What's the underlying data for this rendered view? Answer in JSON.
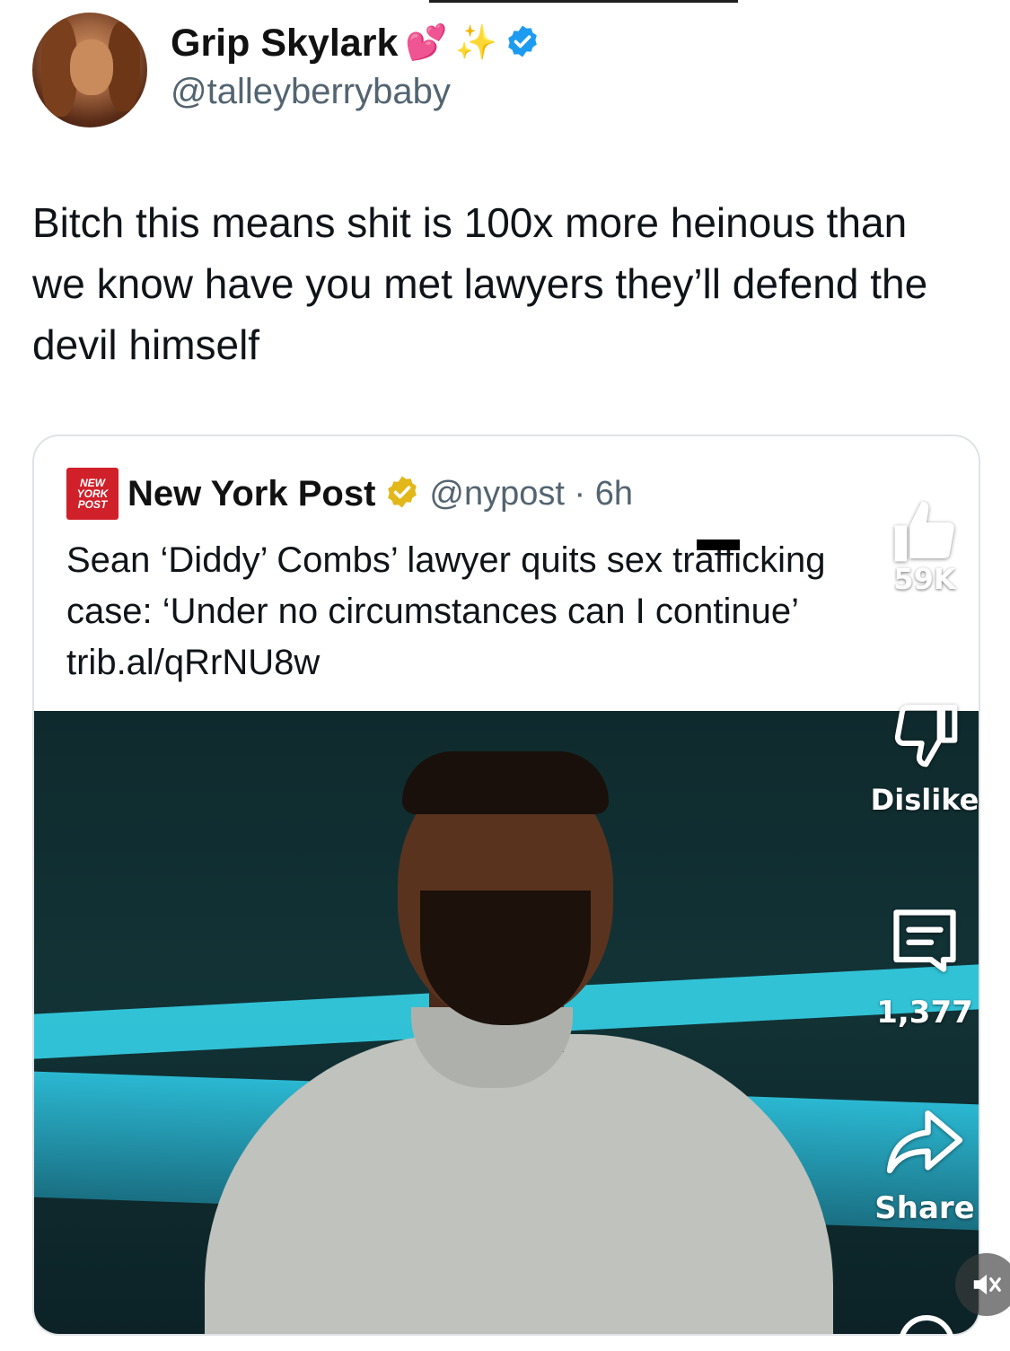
{
  "tweet": {
    "display_name": "Grip Skylark",
    "handle": "@talleyberrybaby",
    "emojis": [
      "💕",
      "✨"
    ],
    "text": "Bitch this means shit is 100x more heinous than we know have you met lawyers they’ll defend the devil himself"
  },
  "quoted": {
    "logo_text": "NEW YORK POST",
    "name": "New York Post",
    "handle_time": "@nypost · 6h",
    "text_line1": "Sean ‘Diddy’ Combs’ lawyer quits sex trafficking",
    "text_line2": "case: ‘Under no circumstances can I continue’",
    "link": "trib.al/qRrNU8w"
  },
  "actions": {
    "like_count": "59K",
    "dislike_label": "Dislike",
    "comment_count": "1,377",
    "share_label": "Share"
  },
  "icons": {
    "verified": "verified-badge-icon",
    "gold_check": "gold-verified-badge-icon",
    "like": "thumbs-up-icon",
    "dislike": "thumbs-down-icon",
    "comment": "comment-icon",
    "share": "share-arrow-icon",
    "mute": "mute-speaker-icon"
  },
  "colors": {
    "verified_blue": "#1d9bf0",
    "gold": "#e2b719",
    "nyp_red": "#d0202a"
  }
}
